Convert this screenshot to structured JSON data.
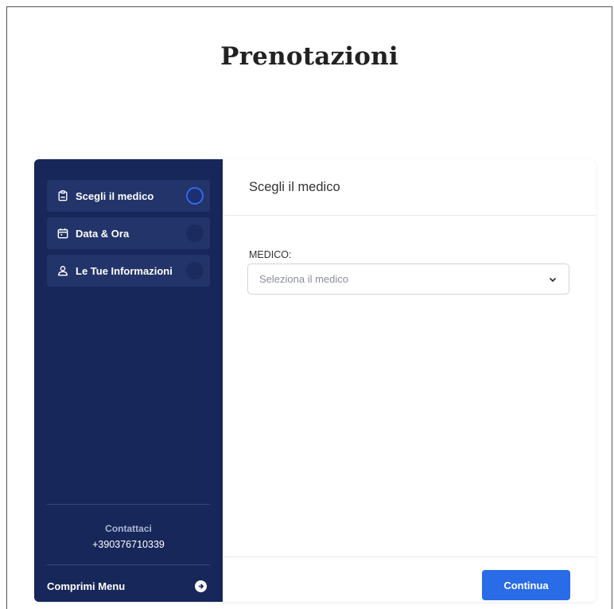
{
  "page": {
    "title": "Prenotazioni"
  },
  "sidebar": {
    "steps": [
      {
        "label": "Scegli il medico",
        "icon": "clipboard-icon",
        "active": true
      },
      {
        "label": "Data & Ora",
        "icon": "calendar-icon",
        "active": false
      },
      {
        "label": "Le Tue Informazioni",
        "icon": "user-icon",
        "active": false
      }
    ],
    "contact_label": "Contattaci",
    "contact_phone": "+390376710339",
    "collapse_label": "Comprimi Menu"
  },
  "main": {
    "header_title": "Scegli il medico",
    "field_label": "MEDICO:",
    "select_placeholder": "Seleziona il medico",
    "continue_label": "Continua"
  },
  "colors": {
    "sidebar_bg": "#17275a",
    "step_bg": "#23346a",
    "accent": "#2a6be8"
  }
}
